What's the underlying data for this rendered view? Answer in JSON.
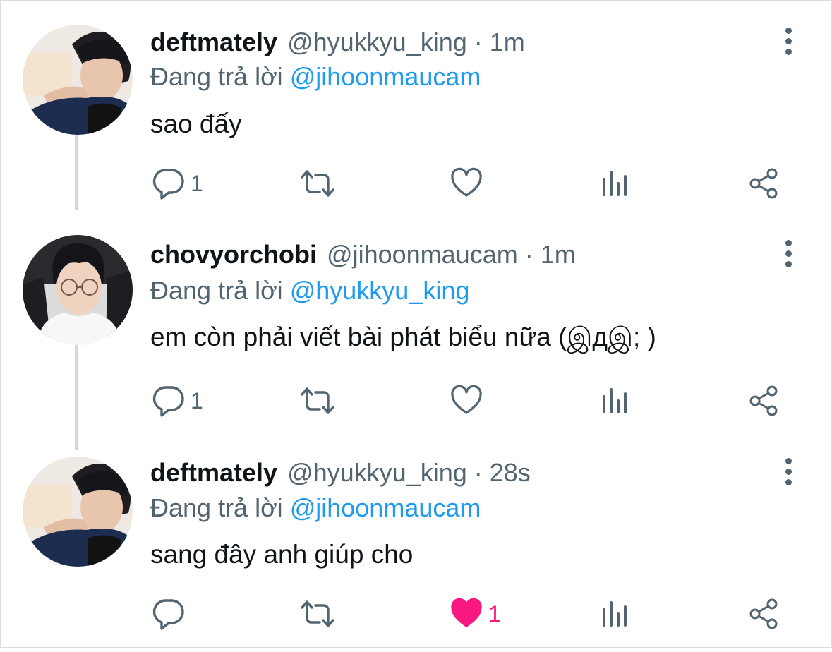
{
  "tweets": [
    {
      "display_name": "deftmately",
      "handle": "@hyukkyu_king",
      "separator": "·",
      "time": "1m",
      "reply_prefix": "Đang trả lời",
      "reply_to": "@jihoonmaucam",
      "text": "sao đấy",
      "reply_count": "1",
      "retweet_count": "",
      "like_count": "",
      "liked": false
    },
    {
      "display_name": "chovyorchobi",
      "handle": "@jihoonmaucam",
      "separator": "·",
      "time": "1m",
      "reply_prefix": "Đang trả lời",
      "reply_to": "@hyukkyu_king",
      "text": "em còn phải viết bài phát biểu nữa (இдஇ; )",
      "reply_count": "1",
      "retweet_count": "",
      "like_count": "",
      "liked": false
    },
    {
      "display_name": "deftmately",
      "handle": "@hyukkyu_king",
      "separator": "·",
      "time": "28s",
      "reply_prefix": "Đang trả lời",
      "reply_to": "@jihoonmaucam",
      "text": "sang đây anh giúp cho",
      "reply_count": "",
      "retweet_count": "",
      "like_count": "1",
      "liked": true
    }
  ],
  "icons": {
    "reply": "reply-icon",
    "retweet": "retweet-icon",
    "like": "heart-icon",
    "views": "views-icon",
    "share": "share-icon",
    "more": "more-vertical-icon"
  },
  "colors": {
    "text": "#0f1419",
    "secondary": "#536471",
    "mention": "#1d9bf0",
    "like_active": "#f91880",
    "thread_line": "#cfd9de"
  }
}
